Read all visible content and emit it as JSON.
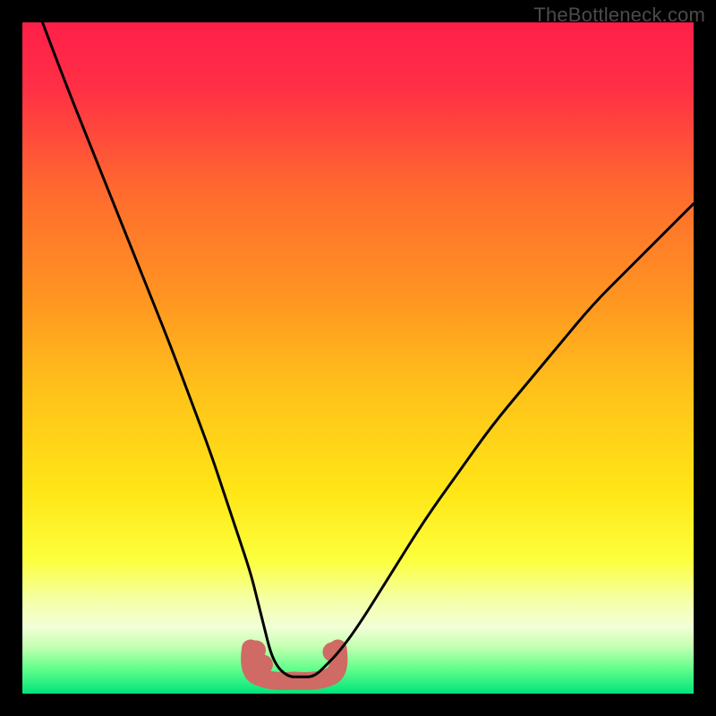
{
  "watermark": "TheBottleneck.com",
  "colors": {
    "frame": "#000000",
    "gradient_stops": [
      {
        "offset": 0.0,
        "color": "#ff1f4a"
      },
      {
        "offset": 0.1,
        "color": "#ff3045"
      },
      {
        "offset": 0.25,
        "color": "#ff6a2f"
      },
      {
        "offset": 0.4,
        "color": "#ff9222"
      },
      {
        "offset": 0.55,
        "color": "#ffc21a"
      },
      {
        "offset": 0.7,
        "color": "#ffe617"
      },
      {
        "offset": 0.8,
        "color": "#fcff3c"
      },
      {
        "offset": 0.86,
        "color": "#f4ffa6"
      },
      {
        "offset": 0.9,
        "color": "#f2ffd6"
      },
      {
        "offset": 0.93,
        "color": "#c4ffb2"
      },
      {
        "offset": 0.96,
        "color": "#6bff8e"
      },
      {
        "offset": 1.0,
        "color": "#00e57a"
      }
    ],
    "curve": "#000000",
    "bump": "#cf6a64"
  },
  "chart_data": {
    "type": "line",
    "title": "",
    "xlabel": "",
    "ylabel": "",
    "xlim": [
      0,
      100
    ],
    "ylim": [
      0,
      100
    ],
    "series": [
      {
        "name": "bottleneck-curve",
        "x": [
          3,
          6,
          10,
          14,
          18,
          22,
          25,
          28,
          30,
          32,
          34,
          35,
          36,
          37,
          38,
          39,
          40,
          41,
          42,
          43,
          44,
          45,
          47,
          50,
          55,
          60,
          65,
          70,
          75,
          80,
          85,
          90,
          95,
          100
        ],
        "y": [
          100,
          92,
          82,
          72,
          62,
          52,
          44,
          36,
          30,
          24,
          18,
          14,
          10,
          6,
          4,
          3,
          2.5,
          2.5,
          2.5,
          2.5,
          3,
          4,
          6,
          10,
          18,
          26,
          33,
          40,
          46,
          52,
          58,
          63,
          68,
          73
        ]
      }
    ],
    "annotations": [
      {
        "name": "optimal-bump",
        "shape": "rounded-blob",
        "x_range": [
          34,
          47
        ],
        "y_level": 3
      }
    ]
  }
}
